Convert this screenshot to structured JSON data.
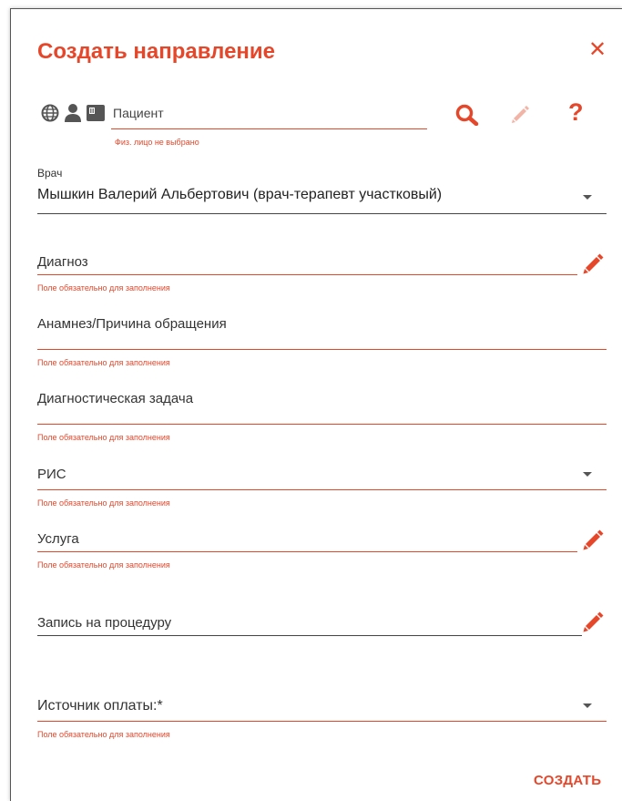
{
  "dialog": {
    "title": "Создать направление",
    "close_symbol": "✕",
    "create_label": "СОЗДАТЬ"
  },
  "patient": {
    "placeholder": "Пациент",
    "error": "Физ. лицо не выбрано",
    "icons": [
      "globe-icon",
      "person-icon",
      "card-icon",
      "search-icon",
      "edit-icon",
      "help-icon"
    ]
  },
  "doctor": {
    "label": "Врач",
    "value": "Мышкин Валерий Альбертович (врач-терапевт участковый)"
  },
  "diagnosis": {
    "label": "Диагноз",
    "error": "Поле обязательно для заполнения"
  },
  "anamnesis": {
    "label": "Анамнез/Причина обращения",
    "error": "Поле обязательно для заполнения"
  },
  "diag_task": {
    "label": "Диагностическая задача",
    "error": "Поле обязательно для заполнения"
  },
  "ris": {
    "label": "РИС",
    "error": "Поле обязательно для заполнения"
  },
  "service": {
    "label": "Услуга",
    "error": "Поле обязательно для заполнения"
  },
  "procedure": {
    "label": "Запись на процедуру"
  },
  "payment": {
    "label": "Источник оплаты:*",
    "error": "Поле обязательно для заполнения"
  },
  "colors": {
    "accent": "#e5472b",
    "text": "#222222",
    "muted": "#555555"
  }
}
